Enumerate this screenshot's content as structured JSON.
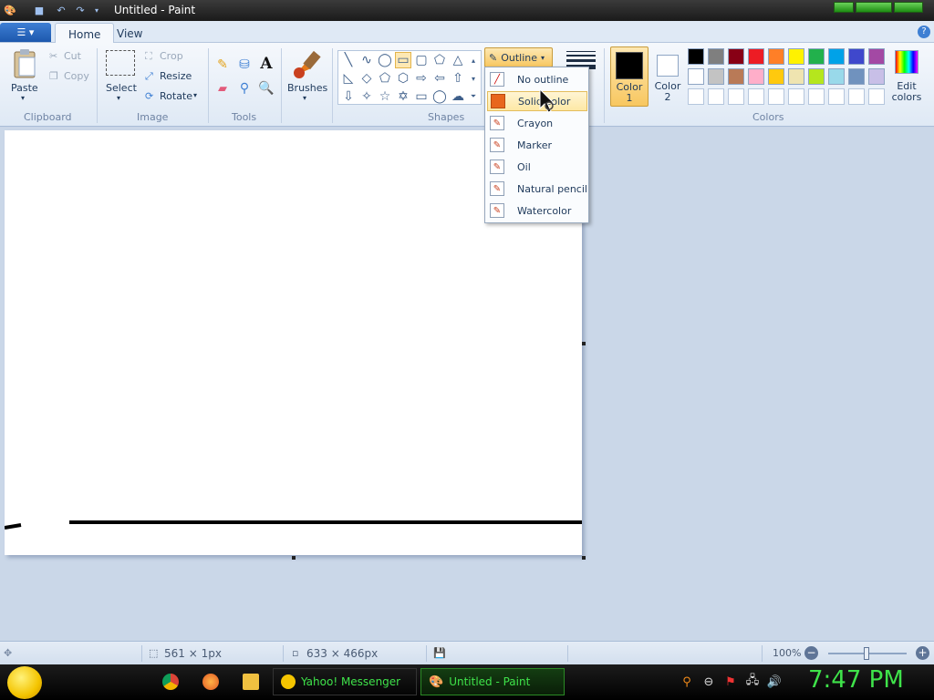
{
  "window": {
    "title": "Untitled - Paint"
  },
  "tabs": {
    "home": "Home",
    "view": "View"
  },
  "clipboard": {
    "paste": "Paste",
    "cut": "Cut",
    "copy": "Copy",
    "group": "Clipboard"
  },
  "image": {
    "select": "Select",
    "crop": "Crop",
    "resize": "Resize",
    "rotate": "Rotate",
    "group": "Image"
  },
  "tools": {
    "group": "Tools",
    "text_glyph": "A"
  },
  "brushes": {
    "label": "Brushes"
  },
  "shapes": {
    "group": "Shapes",
    "outline_label": "Outline"
  },
  "colors": {
    "color1": "Color\n1",
    "color1_a": "Color",
    "color1_b": "1",
    "color2_a": "Color",
    "color2_b": "2",
    "edit_a": "Edit",
    "edit_b": "colors",
    "group": "Colors",
    "palette_row1": [
      "#000000",
      "#7f7f7f",
      "#880015",
      "#ed1c24",
      "#ff7f27",
      "#fff200",
      "#22b14c",
      "#00a2e8",
      "#3f48cc",
      "#a349a4"
    ],
    "palette_row2": [
      "#ffffff",
      "#c3c3c3",
      "#b97a57",
      "#ffaec9",
      "#ffc90e",
      "#efe4b0",
      "#b5e61d",
      "#99d9ea",
      "#7092be",
      "#c8bfe7"
    ],
    "active_color1": "#000000",
    "active_color2": "#ffffff"
  },
  "outline_menu": {
    "items": [
      {
        "label": "No outline"
      },
      {
        "label": "Solid color"
      },
      {
        "label": "Crayon"
      },
      {
        "label": "Marker"
      },
      {
        "label": "Oil"
      },
      {
        "label": "Natural pencil"
      },
      {
        "label": "Watercolor"
      }
    ],
    "hovered_index": 1
  },
  "status": {
    "selection_size": "561 × 1px",
    "canvas_size": "633 × 466px",
    "zoom": "100%"
  },
  "taskbar": {
    "yahoo": "Yahoo! Messenger",
    "paint": "Untitled - Paint",
    "clock": "7:47 PM"
  }
}
